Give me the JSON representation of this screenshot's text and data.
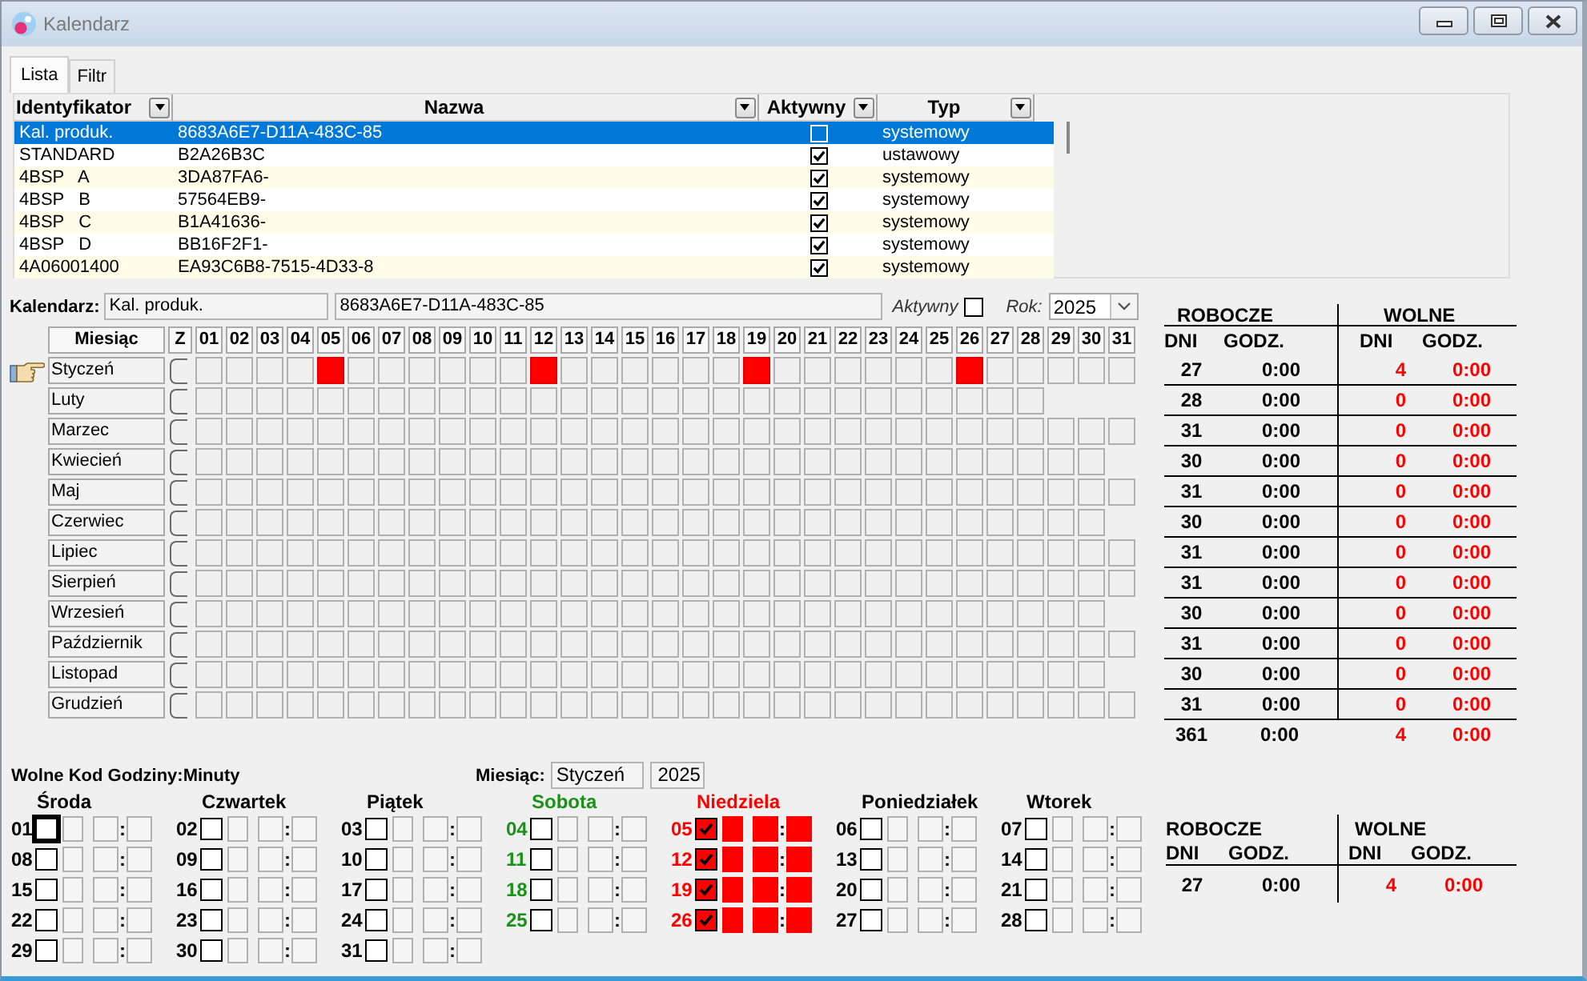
{
  "window": {
    "title": "Kalendarz"
  },
  "tabs": [
    {
      "label": "Lista",
      "selected": true
    },
    {
      "label": "Filtr",
      "selected": false
    }
  ],
  "list": {
    "columns": [
      "Identyfikator",
      "Nazwa",
      "Aktywny",
      "Typ"
    ],
    "rows": [
      {
        "id": "Kal. produk.",
        "name": "8683A6E7-D11A-483C-85",
        "active": false,
        "type": "systemowy",
        "selected": true
      },
      {
        "id": "STANDARD",
        "name": "B2A26B3C",
        "active": true,
        "type": "ustawowy",
        "selected": false
      },
      {
        "id": "4BSP   A",
        "name": "3DA87FA6-",
        "active": true,
        "type": "systemowy",
        "selected": false
      },
      {
        "id": "4BSP   B",
        "name": "57564EB9-",
        "active": true,
        "type": "systemowy",
        "selected": false
      },
      {
        "id": "4BSP   C",
        "name": "B1A41636-",
        "active": true,
        "type": "systemowy",
        "selected": false
      },
      {
        "id": "4BSP   D",
        "name": "BB16F2F1-",
        "active": true,
        "type": "systemowy",
        "selected": false
      },
      {
        "id": "4A06001400",
        "name": "EA93C6B8-7515-4D33-8",
        "active": true,
        "type": "systemowy",
        "selected": false
      }
    ]
  },
  "calendar": {
    "label": "Kalendarz:",
    "id": "Kal. produk.",
    "name": "8683A6E7-D11A-483C-85",
    "active_label": "Aktywny",
    "active": false,
    "year_label": "Rok:",
    "year": "2025"
  },
  "grid": {
    "month_header": "Miesiąc",
    "z_header": "Z",
    "day_headers": [
      "01",
      "02",
      "03",
      "04",
      "05",
      "06",
      "07",
      "08",
      "09",
      "10",
      "11",
      "12",
      "13",
      "14",
      "15",
      "16",
      "17",
      "18",
      "19",
      "20",
      "21",
      "22",
      "23",
      "24",
      "25",
      "26",
      "27",
      "28",
      "29",
      "30",
      "31"
    ],
    "months": [
      {
        "name": "Styczeń",
        "current": true,
        "z_checked": false,
        "free": [
          false,
          false,
          false,
          false,
          true,
          false,
          false,
          false,
          false,
          false,
          false,
          true,
          false,
          false,
          false,
          false,
          false,
          false,
          true,
          false,
          false,
          false,
          false,
          false,
          false,
          true,
          false,
          false,
          false,
          false,
          false
        ]
      },
      {
        "name": "Luty",
        "current": false,
        "z_checked": false,
        "free": [
          false,
          false,
          false,
          false,
          false,
          false,
          false,
          false,
          false,
          false,
          false,
          false,
          false,
          false,
          false,
          false,
          false,
          false,
          false,
          false,
          false,
          false,
          false,
          false,
          false,
          false,
          false,
          false
        ]
      },
      {
        "name": "Marzec",
        "current": false,
        "z_checked": false,
        "free": [
          false,
          false,
          false,
          false,
          false,
          false,
          false,
          false,
          false,
          false,
          false,
          false,
          false,
          false,
          false,
          false,
          false,
          false,
          false,
          false,
          false,
          false,
          false,
          false,
          false,
          false,
          false,
          false,
          false,
          false,
          false
        ]
      },
      {
        "name": "Kwiecień",
        "current": false,
        "z_checked": false,
        "free": [
          false,
          false,
          false,
          false,
          false,
          false,
          false,
          false,
          false,
          false,
          false,
          false,
          false,
          false,
          false,
          false,
          false,
          false,
          false,
          false,
          false,
          false,
          false,
          false,
          false,
          false,
          false,
          false,
          false,
          false
        ]
      },
      {
        "name": "Maj",
        "current": false,
        "z_checked": false,
        "free": [
          false,
          false,
          false,
          false,
          false,
          false,
          false,
          false,
          false,
          false,
          false,
          false,
          false,
          false,
          false,
          false,
          false,
          false,
          false,
          false,
          false,
          false,
          false,
          false,
          false,
          false,
          false,
          false,
          false,
          false,
          false
        ]
      },
      {
        "name": "Czerwiec",
        "current": false,
        "z_checked": false,
        "free": [
          false,
          false,
          false,
          false,
          false,
          false,
          false,
          false,
          false,
          false,
          false,
          false,
          false,
          false,
          false,
          false,
          false,
          false,
          false,
          false,
          false,
          false,
          false,
          false,
          false,
          false,
          false,
          false,
          false,
          false
        ]
      },
      {
        "name": "Lipiec",
        "current": false,
        "z_checked": false,
        "free": [
          false,
          false,
          false,
          false,
          false,
          false,
          false,
          false,
          false,
          false,
          false,
          false,
          false,
          false,
          false,
          false,
          false,
          false,
          false,
          false,
          false,
          false,
          false,
          false,
          false,
          false,
          false,
          false,
          false,
          false,
          false
        ]
      },
      {
        "name": "Sierpień",
        "current": false,
        "z_checked": false,
        "free": [
          false,
          false,
          false,
          false,
          false,
          false,
          false,
          false,
          false,
          false,
          false,
          false,
          false,
          false,
          false,
          false,
          false,
          false,
          false,
          false,
          false,
          false,
          false,
          false,
          false,
          false,
          false,
          false,
          false,
          false,
          false
        ]
      },
      {
        "name": "Wrzesień",
        "current": false,
        "z_checked": false,
        "free": [
          false,
          false,
          false,
          false,
          false,
          false,
          false,
          false,
          false,
          false,
          false,
          false,
          false,
          false,
          false,
          false,
          false,
          false,
          false,
          false,
          false,
          false,
          false,
          false,
          false,
          false,
          false,
          false,
          false,
          false
        ]
      },
      {
        "name": "Październik",
        "current": false,
        "z_checked": false,
        "free": [
          false,
          false,
          false,
          false,
          false,
          false,
          false,
          false,
          false,
          false,
          false,
          false,
          false,
          false,
          false,
          false,
          false,
          false,
          false,
          false,
          false,
          false,
          false,
          false,
          false,
          false,
          false,
          false,
          false,
          false,
          false
        ]
      },
      {
        "name": "Listopad",
        "current": false,
        "z_checked": false,
        "free": [
          false,
          false,
          false,
          false,
          false,
          false,
          false,
          false,
          false,
          false,
          false,
          false,
          false,
          false,
          false,
          false,
          false,
          false,
          false,
          false,
          false,
          false,
          false,
          false,
          false,
          false,
          false,
          false,
          false,
          false
        ]
      },
      {
        "name": "Grudzień",
        "current": false,
        "z_checked": false,
        "free": [
          false,
          false,
          false,
          false,
          false,
          false,
          false,
          false,
          false,
          false,
          false,
          false,
          false,
          false,
          false,
          false,
          false,
          false,
          false,
          false,
          false,
          false,
          false,
          false,
          false,
          false,
          false,
          false,
          false,
          false,
          false
        ]
      }
    ]
  },
  "summary": {
    "work_header": "ROBOCZE",
    "free_header": "WOLNE",
    "col_headers": [
      "DNI",
      "GODZ.",
      "DNI",
      "GODZ."
    ],
    "rows": [
      {
        "work_days": "27",
        "work_hours": "0:00",
        "free_days": "4",
        "free_hours": "0:00"
      },
      {
        "work_days": "28",
        "work_hours": "0:00",
        "free_days": "0",
        "free_hours": "0:00"
      },
      {
        "work_days": "31",
        "work_hours": "0:00",
        "free_days": "0",
        "free_hours": "0:00"
      },
      {
        "work_days": "30",
        "work_hours": "0:00",
        "free_days": "0",
        "free_hours": "0:00"
      },
      {
        "work_days": "31",
        "work_hours": "0:00",
        "free_days": "0",
        "free_hours": "0:00"
      },
      {
        "work_days": "30",
        "work_hours": "0:00",
        "free_days": "0",
        "free_hours": "0:00"
      },
      {
        "work_days": "31",
        "work_hours": "0:00",
        "free_days": "0",
        "free_hours": "0:00"
      },
      {
        "work_days": "31",
        "work_hours": "0:00",
        "free_days": "0",
        "free_hours": "0:00"
      },
      {
        "work_days": "30",
        "work_hours": "0:00",
        "free_days": "0",
        "free_hours": "0:00"
      },
      {
        "work_days": "31",
        "work_hours": "0:00",
        "free_days": "0",
        "free_hours": "0:00"
      },
      {
        "work_days": "30",
        "work_hours": "0:00",
        "free_days": "0",
        "free_hours": "0:00"
      },
      {
        "work_days": "31",
        "work_hours": "0:00",
        "free_days": "0",
        "free_hours": "0:00"
      }
    ],
    "total": {
      "work_days": "361",
      "work_hours": "0:00",
      "free_days": "4",
      "free_hours": "0:00"
    }
  },
  "codes": {
    "title": "Wolne Kod Godziny:Minuty",
    "month_label": "Miesiąc:",
    "month": "Styczeń",
    "year": "2025",
    "columns": [
      {
        "label": "Środa",
        "color": "#000000",
        "days": [
          {
            "day": "01",
            "checked": false,
            "focused": true,
            "sep": ":"
          },
          {
            "day": "08",
            "checked": false,
            "focused": false,
            "sep": ":"
          },
          {
            "day": "15",
            "checked": false,
            "focused": false,
            "sep": ":"
          },
          {
            "day": "22",
            "checked": false,
            "focused": false,
            "sep": ":"
          },
          {
            "day": "29",
            "checked": false,
            "focused": false,
            "sep": ":"
          }
        ]
      },
      {
        "label": "Czwartek",
        "color": "#000000",
        "days": [
          {
            "day": "02",
            "checked": false,
            "focused": false,
            "sep": ":"
          },
          {
            "day": "09",
            "checked": false,
            "focused": false,
            "sep": ":"
          },
          {
            "day": "16",
            "checked": false,
            "focused": false,
            "sep": ":"
          },
          {
            "day": "23",
            "checked": false,
            "focused": false,
            "sep": ":"
          },
          {
            "day": "30",
            "checked": false,
            "focused": false,
            "sep": ":"
          }
        ]
      },
      {
        "label": "Piątek",
        "color": "#000000",
        "days": [
          {
            "day": "03",
            "checked": false,
            "focused": false,
            "sep": ":"
          },
          {
            "day": "10",
            "checked": false,
            "focused": false,
            "sep": ":"
          },
          {
            "day": "17",
            "checked": false,
            "focused": false,
            "sep": ":"
          },
          {
            "day": "24",
            "checked": false,
            "focused": false,
            "sep": ":"
          },
          {
            "day": "31",
            "checked": false,
            "focused": false,
            "sep": ":"
          }
        ]
      },
      {
        "label": "Sobota",
        "color": "#1a921a",
        "days": [
          {
            "day": "04",
            "checked": false,
            "focused": false,
            "sep": ":"
          },
          {
            "day": "11",
            "checked": false,
            "focused": false,
            "sep": ":"
          },
          {
            "day": "18",
            "checked": false,
            "focused": false,
            "sep": ":"
          },
          {
            "day": "25",
            "checked": false,
            "focused": false,
            "sep": ":"
          }
        ]
      },
      {
        "label": "Niedziela",
        "color": "#ff0000",
        "days": [
          {
            "day": "05",
            "checked": true,
            "focused": false,
            "sep": ":"
          },
          {
            "day": "12",
            "checked": true,
            "focused": false,
            "sep": ":"
          },
          {
            "day": "19",
            "checked": true,
            "focused": false,
            "sep": ":"
          },
          {
            "day": "26",
            "checked": true,
            "focused": false,
            "sep": ":"
          }
        ]
      },
      {
        "label": "Poniedziałek",
        "color": "#000000",
        "days": [
          {
            "day": "06",
            "checked": false,
            "focused": false,
            "sep": ":"
          },
          {
            "day": "13",
            "checked": false,
            "focused": false,
            "sep": ":"
          },
          {
            "day": "20",
            "checked": false,
            "focused": false,
            "sep": ":"
          },
          {
            "day": "27",
            "checked": false,
            "focused": false,
            "sep": ":"
          }
        ]
      },
      {
        "label": "Wtorek",
        "color": "#000000",
        "days": [
          {
            "day": "07",
            "checked": false,
            "focused": false,
            "sep": ":"
          },
          {
            "day": "14",
            "checked": false,
            "focused": false,
            "sep": ":"
          },
          {
            "day": "21",
            "checked": false,
            "focused": false,
            "sep": ":"
          },
          {
            "day": "28",
            "checked": false,
            "focused": false,
            "sep": ":"
          }
        ]
      }
    ]
  },
  "codes_summary": {
    "work_header": "ROBOCZE",
    "free_header": "WOLNE",
    "col_headers": [
      "DNI",
      "GODZ.",
      "DNI",
      "GODZ."
    ],
    "work_days": "27",
    "work_hours": "0:00",
    "free_days": "4",
    "free_hours": "0:00"
  }
}
